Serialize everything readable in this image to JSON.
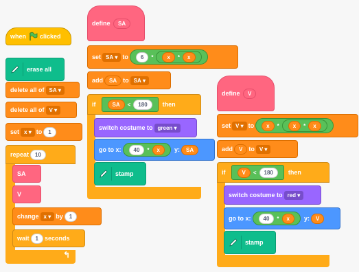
{
  "script1": {
    "when_label": "when",
    "clicked_label": "clicked",
    "erase_all_label": "erase all",
    "delete_all_of_label": "delete all of",
    "delete_list_1": "SA",
    "delete_list_2": "V",
    "set_label": "set",
    "set_var": "x",
    "to_label": "to",
    "set_value": "1",
    "repeat_label": "repeat",
    "repeat_value": "10",
    "call_1": "SA",
    "call_2": "V",
    "change_label": "change",
    "change_var": "x",
    "by_label": "by",
    "change_value": "1",
    "wait_label": "wait",
    "wait_value": "1",
    "seconds_label": "seconds"
  },
  "script2": {
    "define_label": "define",
    "define_name": "SA",
    "set_label": "set",
    "set_var": "SA",
    "to_label": "to",
    "expr_num": "6",
    "expr_op1": "*",
    "expr_v1": "x",
    "expr_op2": "*",
    "expr_v2": "x",
    "add_label": "add",
    "add_item": "SA",
    "add_to_label": "to",
    "add_list": "SA",
    "if_label": "if",
    "cond_var": "SA",
    "cond_op": "<",
    "cond_value": "180",
    "then_label": "then",
    "switch_label": "switch costume to",
    "costume": "green",
    "goto_label": "go to x:",
    "goto_x": "40",
    "goto_op": "*",
    "goto_xv": "x",
    "goto_y_label": "y:",
    "goto_y": "SA",
    "stamp_label": "stamp"
  },
  "script3": {
    "define_label": "define",
    "define_name": "V",
    "set_label": "set",
    "set_var": "V",
    "to_label": "to",
    "expr_v1": "x",
    "expr_op1": "*",
    "expr_v2": "x",
    "expr_op2": "*",
    "expr_v3": "x",
    "add_label": "add",
    "add_item": "V",
    "add_to_label": "to",
    "add_list": "V",
    "if_label": "if",
    "cond_var": "V",
    "cond_op": "<",
    "cond_value": "180",
    "then_label": "then",
    "switch_label": "switch costume to",
    "costume": "red",
    "goto_label": "go to x:",
    "goto_x": "40",
    "goto_op": "*",
    "goto_xv": "x",
    "goto_y_label": "y:",
    "goto_y": "V",
    "stamp_label": "stamp"
  },
  "icons": {
    "flag": "green-flag-icon",
    "pen": "pen-icon",
    "loop": "loop-arrow-icon"
  },
  "colors": {
    "events": "#ffbf00",
    "pen": "#0fbd8c",
    "variables": "#ff8c1a",
    "control": "#ffab19",
    "looks": "#9966ff",
    "motion": "#4c97ff",
    "my_blocks": "#ff6680",
    "operators": "#59c059"
  }
}
